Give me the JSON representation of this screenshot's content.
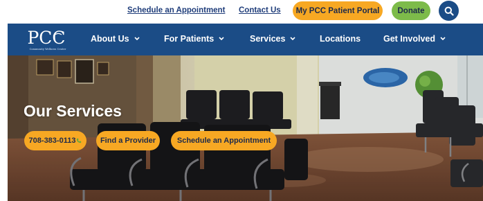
{
  "utility": {
    "schedule_link": "Schedule an Appointment",
    "contact_link": "Contact Us",
    "portal_button": "My PCC Patient Portal",
    "donate_button": "Donate",
    "search_icon": "search-icon"
  },
  "brand": {
    "logo_text": "PCC",
    "logo_subtitle": "Community Wellness Center"
  },
  "nav": {
    "items": [
      {
        "label": "About Us",
        "has_dropdown": true
      },
      {
        "label": "For Patients",
        "has_dropdown": true
      },
      {
        "label": "Services",
        "has_dropdown": true
      },
      {
        "label": "Locations",
        "has_dropdown": false
      },
      {
        "label": "Get Involved",
        "has_dropdown": true
      }
    ]
  },
  "hero": {
    "title": "Our Services",
    "phone_button": "708-383-0113",
    "phone_icon": "phone-icon",
    "provider_button": "Find a Provider",
    "schedule_button": "Schedule an Appointment"
  },
  "colors": {
    "navy": "#1b4c86",
    "orange": "#f7a823",
    "green": "#7dbb4a",
    "link": "#1f3d7a"
  }
}
